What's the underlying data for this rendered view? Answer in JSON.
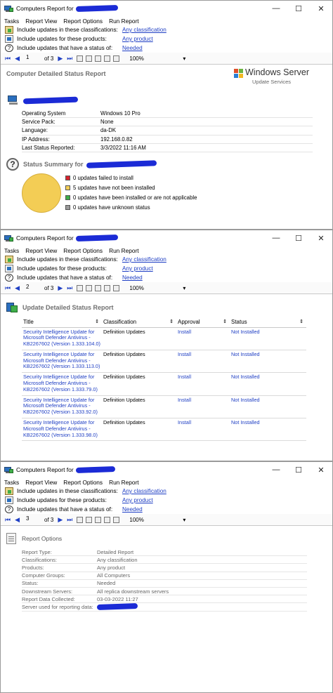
{
  "window": {
    "title_prefix": "Computers Report for",
    "controls": {
      "minimize": "—",
      "maximize": "☐",
      "close": "✕"
    }
  },
  "menu": [
    "Tasks",
    "Report View",
    "Report Options",
    "Run Report"
  ],
  "criteria": [
    {
      "label": "Include updates in these classifications:",
      "value": "Any classification",
      "icon": "classification-icon"
    },
    {
      "label": "Include updates for these products:",
      "value": "Any product",
      "icon": "product-icon"
    },
    {
      "label": "Include updates that have a status of:",
      "value": "Needed",
      "icon": "question-icon"
    }
  ],
  "toolbar": {
    "of_label": "of 3",
    "zoom": "100%",
    "pages": [
      "1",
      "2",
      "3"
    ]
  },
  "page1": {
    "report_title": "Computer Detailed Status Report",
    "logo": {
      "brand": "Windows Server",
      "sub": "Update Services"
    },
    "details": [
      {
        "key": "Operating System",
        "value": "Windows 10 Pro"
      },
      {
        "key": "Service Pack:",
        "value": "None"
      },
      {
        "key": "Language:",
        "value": "da-DK"
      },
      {
        "key": "IP Address:",
        "value": "192.168.0.82"
      },
      {
        "key": "Last Status Reported:",
        "value": "3/3/2022 11:16 AM"
      }
    ],
    "summary_title": "Status Summary for",
    "legend": [
      {
        "text": "0 updates failed to install",
        "color": "#d9232e"
      },
      {
        "text": "5 updates have not been installed",
        "color": "#f3cd55"
      },
      {
        "text": "0 updates have been installed or are not applicable",
        "color": "#3fae49"
      },
      {
        "text": "0 updates have unknown status",
        "color": "#9a9a9a"
      }
    ]
  },
  "page2": {
    "report_title": "Update Detailed Status Report",
    "columns": [
      "Title",
      "Classification",
      "Approval",
      "Status"
    ],
    "rows": [
      {
        "title": "Security Intelligence Update for Microsoft Defender Antivirus - KB2267602 (Version 1.333.104.0)",
        "classification": "Definition Updates",
        "approval": "Install",
        "status": "Not Installed"
      },
      {
        "title": "Security Intelligence Update for Microsoft Defender Antivirus - KB2267602 (Version 1.333.113.0)",
        "classification": "Definition Updates",
        "approval": "Install",
        "status": "Not Installed"
      },
      {
        "title": "Security Intelligence Update for Microsoft Defender Antivirus - KB2267602 (Version 1.333.79.0)",
        "classification": "Definition Updates",
        "approval": "Install",
        "status": "Not Installed"
      },
      {
        "title": "Security Intelligence Update for Microsoft Defender Antivirus - KB2267602 (Version 1.333.92.0)",
        "classification": "Definition Updates",
        "approval": "Install",
        "status": "Not Installed"
      },
      {
        "title": "Security Intelligence Update for Microsoft Defender Antivirus - KB2267602 (Version 1.333.98.0)",
        "classification": "Definition Updates",
        "approval": "Install",
        "status": "Not Installed"
      }
    ]
  },
  "page3": {
    "report_title": "Report Options",
    "options": [
      {
        "key": "Report Type:",
        "value": "Detailed Report"
      },
      {
        "key": "Classifications:",
        "value": "Any classification"
      },
      {
        "key": "Products:",
        "value": "Any product"
      },
      {
        "key": "Computer Groups:",
        "value": "All Computers"
      },
      {
        "key": "Status:",
        "value": "Needed"
      },
      {
        "key": "Downstream Servers:",
        "value": "All replica downstream servers"
      },
      {
        "key": "Report Data Collected:",
        "value": "03-03-2022 11:27"
      },
      {
        "key": "Server used for reporting data:",
        "value": ""
      }
    ]
  }
}
